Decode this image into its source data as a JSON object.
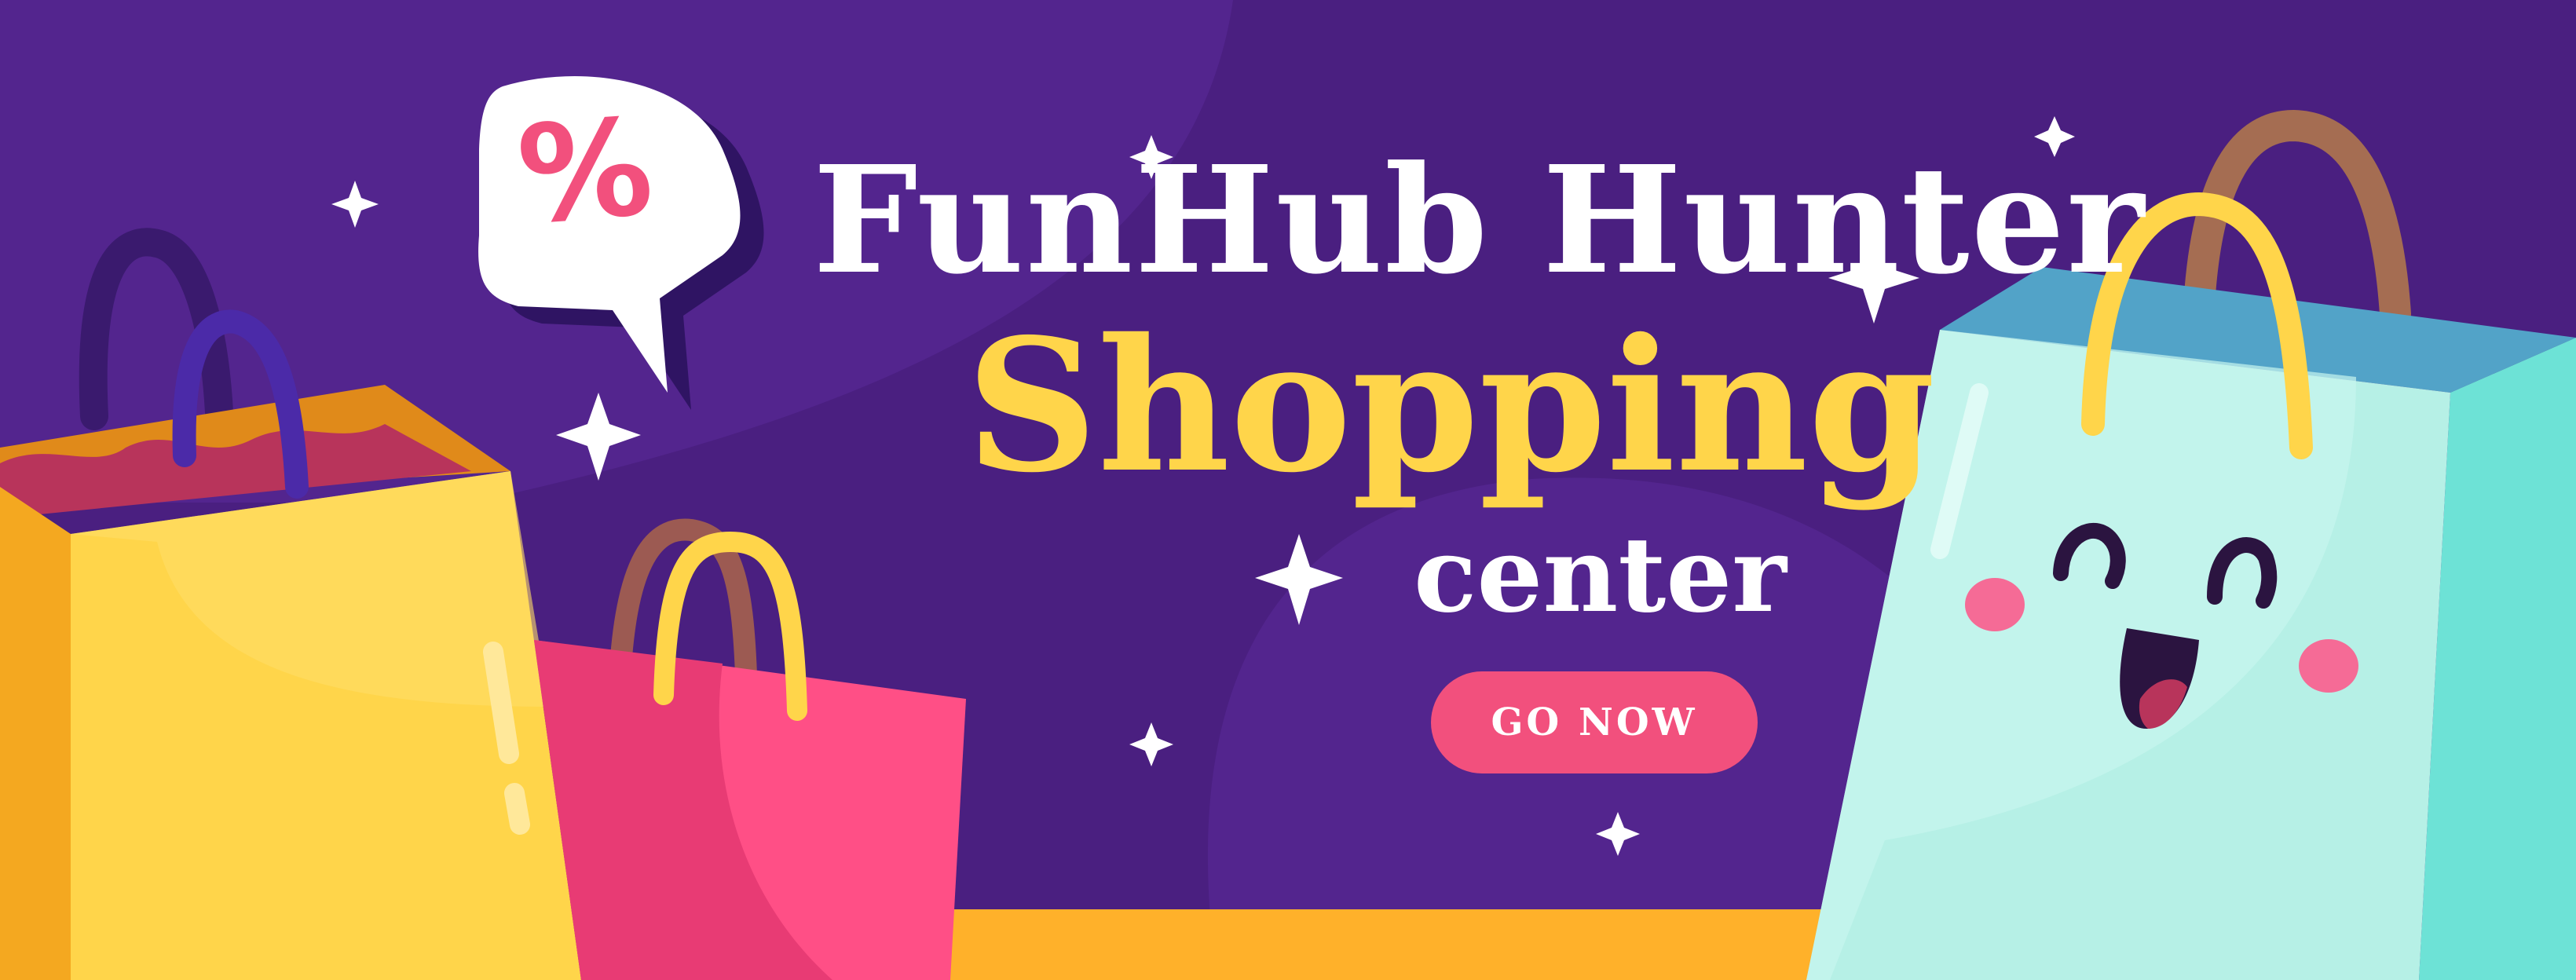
{
  "banner": {
    "brand_title": "FunHub Hunter",
    "headline": "Shopping",
    "subheadline": "center",
    "cta_label": "GO NOW",
    "sale_badge_symbol": "%"
  },
  "colors": {
    "background": "#4a1f80",
    "accent_yellow": "#ffd54a",
    "accent_pink": "#f2507d",
    "bag_mint": "#b6f0e6",
    "bag_yellow": "#ffd54a",
    "bag_pink": "#ff4f86",
    "ground_orange": "#ffb12a"
  },
  "icons": [
    "percent-speech-bubble-icon",
    "sparkle-icon",
    "shopping-bag-icon",
    "smiling-bag-face-icon"
  ]
}
